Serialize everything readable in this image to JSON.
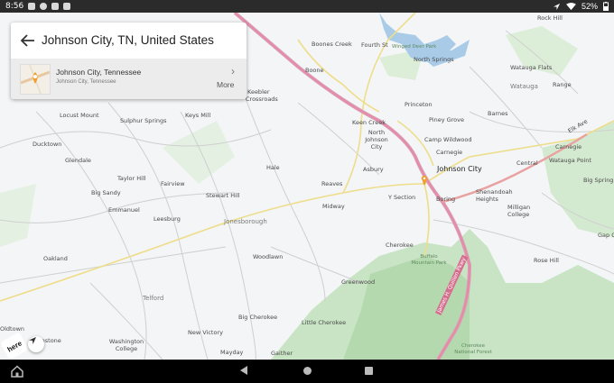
{
  "status_bar": {
    "time": "8:56",
    "battery": "52%",
    "left_icons": [
      "photo-icon",
      "play-icon",
      "youtube-icon",
      "document-icon"
    ],
    "right_icons": [
      "location-icon",
      "wifi-icon",
      "battery-icon"
    ]
  },
  "search": {
    "query": "Johnson City, TN, United States",
    "back_icon": "back-arrow-icon"
  },
  "result": {
    "title": "Johnson City, Tennessee",
    "subtitle": "Johnson City, Tennessee",
    "more_label": "More",
    "chevron_icon": "chevron-right-icon",
    "thumb_icon": "map-pin-icon"
  },
  "map": {
    "logo_text": "here",
    "compass_icon": "compass-arrow-icon",
    "labels": {
      "rock_hill": "Rock Hill",
      "boones_creek": "Boones Creek",
      "fourth_st": "Fourth St",
      "winged_deer_park": "Winged Deer Park",
      "north_springs": "North Springs",
      "watauga_flats": "Watauga Flats",
      "watauga": "Watauga",
      "boone": "Boone",
      "range": "Range",
      "keebler": "Keebler",
      "crossroads": "Crossroads",
      "locust_mount": "Locust Mount",
      "sulphur_springs": "Sulphur Springs",
      "keys_mill": "Keys Mill",
      "princeton": "Princeton",
      "barnes": "Barnes",
      "keen_creek": "Keen Creek",
      "piney_grove": "Piney Grove",
      "north_johnson_city": "North Johnson City",
      "camp_wildwood": "Camp Wildwood",
      "carnegie": "Carnegie",
      "elk_ave": "Elk Ave",
      "ducktown": "Ducktown",
      "glendale": "Glendale",
      "hale": "Hale",
      "asbury": "Asbury",
      "johnson_city": "Johnson City",
      "central": "Central",
      "watauga_point": "Watauga Point",
      "taylor_hill": "Taylor Hill",
      "fairview": "Fairview",
      "big_spring": "Big Spring",
      "big_sandy": "Big Sandy",
      "stewart_hill": "Stewart Hill",
      "reaves": "Reaves",
      "shenandoah_heights": "Shenandoah Heights",
      "y_section": "Y Section",
      "boring": "Boring",
      "emmanuel": "Emmanuel",
      "midway": "Midway",
      "milligan_college": "Milligan College",
      "leesburg": "Leesburg",
      "jonesborough": "Jonesborough",
      "gap_creek": "Gap Cr",
      "cherokee": "Cherokee",
      "buffalo_mountain_park": "Buffalo Mountain Park",
      "oakland": "Oakland",
      "woodlawn": "Woodlawn",
      "rose_hill": "Rose Hill",
      "greenwood": "Greenwood",
      "telford": "Telford",
      "james_h_quillen_pkwy": "James H. Quillen Pkwy",
      "big_cherokee": "Big Cherokee",
      "little_cherokee": "Little Cherokee",
      "oldtown": "Oldtown",
      "new_victory": "New Victory",
      "limestone": "Limestone",
      "washington_college": "Washington College",
      "cherokee_national_forest": "Cherokee National Forest",
      "mayday": "Mayday",
      "gaither": "Gaither"
    }
  },
  "nav_bar": {
    "home_icon": "home-icon",
    "back_icon": "back-triangle-icon",
    "home_button_icon": "circle-home-icon",
    "recents_icon": "recents-square-icon"
  }
}
